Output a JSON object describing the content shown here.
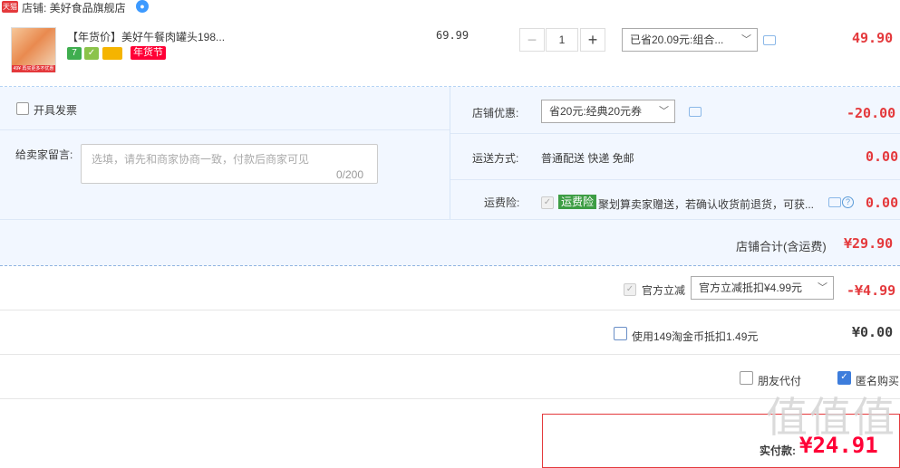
{
  "shop": {
    "badge": "天猫",
    "name": "店铺: 美好食品旗舰店",
    "wangwang": "●"
  },
  "item": {
    "thumb_tag": "49¥ 再买更多不优惠",
    "title": "【年货价】美好午餐肉罐头198...",
    "service_icons": [
      "7",
      "✓",
      ""
    ],
    "festival_tag": "年货节",
    "unit_price": "69.99",
    "quantity": "1",
    "minus": "−",
    "plus": "+",
    "promo_select": "已省20.09元:组合...",
    "subtotal": "49.90"
  },
  "options": {
    "invoice_label": "开具发票",
    "message_label": "给卖家留言:",
    "message_placeholder": "选填，请先和商家协商一致，付款后商家可见",
    "message_count": "0/200",
    "shop_discount_label": "店铺优惠:",
    "shop_discount_select": "省20元:经典20元券",
    "shop_discount_value": "-20.00",
    "shipping_label": "运送方式:",
    "shipping_value": "普通配送 快递 免邮",
    "shipping_fee": "0.00",
    "insurance_label": "运费险:",
    "insurance_tag": "运费险",
    "insurance_text": "聚划算卖家赠送，若确认收货前退货，可获...",
    "insurance_fee": "0.00",
    "help": "?",
    "shop_total_label": "店铺合计(含运费)",
    "shop_total_value": "¥29.90"
  },
  "checkout": {
    "official_label": "官方立减",
    "official_select": "官方立减抵扣¥4.99元",
    "official_value": "-¥4.99",
    "taojinbi_label": "使用149淘金币抵扣1.49元",
    "taojinbi_value": "¥0.00",
    "friend_pay_label": "朋友代付",
    "anonymous_label": "匿名购买",
    "pay_label": "实付款:",
    "pay_value": "¥24.91"
  },
  "watermark": "值值值",
  "colors": {
    "accent_red": "#e4393c",
    "panel_blue": "#f2f7ff",
    "checkbox_blue": "#3d7ddc",
    "tag_green": "#3d9d44"
  }
}
